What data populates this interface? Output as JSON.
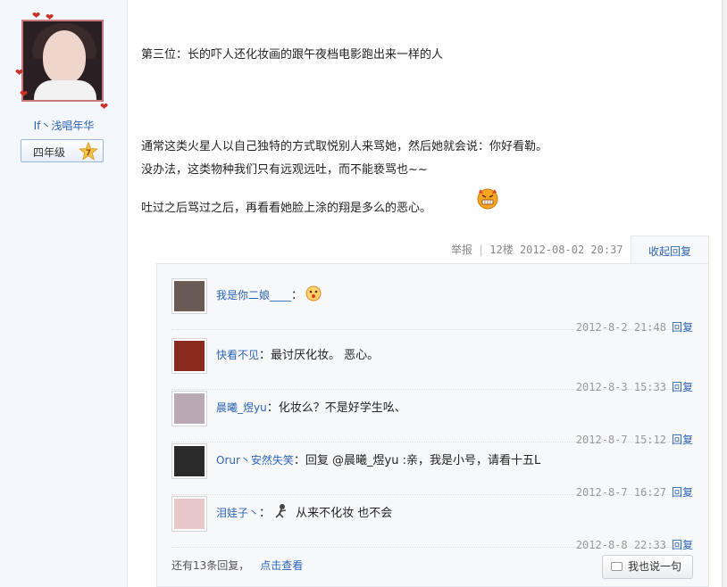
{
  "author": {
    "name": "If丶浅唱年华",
    "grade_label": "四年级",
    "grade_level": "7"
  },
  "post": {
    "line1": "第三位：长的吓人还化妆画的跟午夜档电影跑出来一样的人",
    "line2": "通常这类火星人以自己独特的方式取悦别人来骂她，然后她就会说：你好看勒。",
    "line3": "没办法，这类物种我们只有远观远吐，而不能亵骂也~~",
    "line4": "吐过之后骂过之后，再看看她脸上涂的翔是多么的恶心。"
  },
  "meta": {
    "report": "举报",
    "floor": "12楼",
    "time": "2012-08-02 20:37",
    "collapse_label": "收起回复"
  },
  "comments": [
    {
      "name": "我是你二娘____",
      "text": "：",
      "time": "2012-8-2 21:48",
      "reply": "回复",
      "avatar_color": "#6a5a55",
      "has_emoji": true
    },
    {
      "name": "快看不见",
      "text": "：最讨厌化妆。 恶心。",
      "time": "2012-8-3 15:33",
      "reply": "回复",
      "avatar_color": "#8a2a1e",
      "has_emoji": false
    },
    {
      "name": "晨曦_煜yu",
      "text": "：化妆么？不是好学生吆、",
      "time": "2012-8-7 15:12",
      "reply": "回复",
      "avatar_color": "#b8a9b4",
      "has_emoji": false
    },
    {
      "name": "Orur丶安然失笑",
      "text": "：回复 @晨曦_煜yu :亲，我是小号，请看十五L",
      "time": "2012-8-7 16:27",
      "reply": "回复",
      "avatar_color": "#2a2a2a",
      "has_emoji": false
    },
    {
      "name": "泪娃子丶",
      "text": " 从来不化妆 也不会",
      "prefix": "：",
      "time": "2012-8-8 22:33",
      "reply": "回复",
      "avatar_color": "#e8c7c9",
      "has_emoji": true
    }
  ],
  "footer": {
    "more_text": "还有13条回复，",
    "view_label": "点击查看",
    "say_label": "我也说一句"
  },
  "colors": {
    "link": "#2d64b3",
    "sidebar_bg": "#f4f7fb"
  }
}
